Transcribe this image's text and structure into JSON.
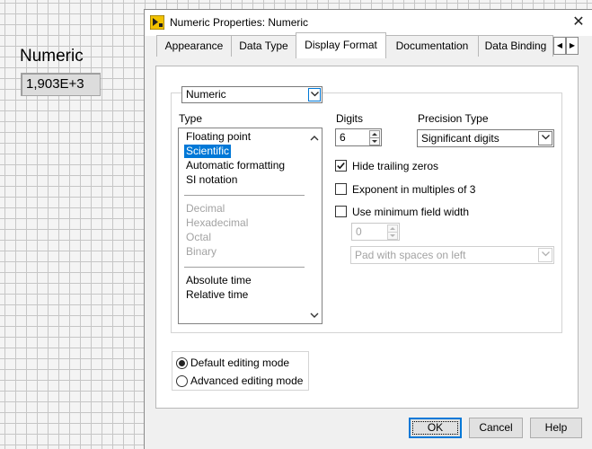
{
  "front_panel": {
    "label": "Numeric",
    "value": "1,903E+3"
  },
  "dialog": {
    "title": "Numeric Properties: Numeric",
    "close_glyph": "✕"
  },
  "tabs": [
    {
      "label": "Appearance"
    },
    {
      "label": "Data Type"
    },
    {
      "label": "Display Format"
    },
    {
      "label": "Documentation"
    },
    {
      "label": "Data Binding"
    }
  ],
  "tab_scroll": {
    "left": "◀",
    "right": "▶"
  },
  "display_format": {
    "format_select": {
      "value": "Numeric"
    },
    "type": {
      "label": "Type",
      "items": [
        {
          "label": "Floating point"
        },
        {
          "label": "Scientific",
          "selected": true
        },
        {
          "label": "Automatic formatting"
        },
        {
          "label": "SI notation"
        },
        {
          "label": "Decimal",
          "disabled": true
        },
        {
          "label": "Hexadecimal",
          "disabled": true
        },
        {
          "label": "Octal",
          "disabled": true
        },
        {
          "label": "Binary",
          "disabled": true
        },
        {
          "label": "Absolute time"
        },
        {
          "label": "Relative time"
        }
      ]
    },
    "digits": {
      "label": "Digits",
      "value": "6"
    },
    "precision_type": {
      "label": "Precision Type",
      "value": "Significant digits"
    },
    "hide_trailing_zeros": {
      "label": "Hide trailing zeros",
      "checked": true
    },
    "exponent_multiples_of_3": {
      "label": "Exponent in multiples of 3",
      "checked": false
    },
    "use_min_field_width": {
      "label": "Use minimum field width",
      "checked": false
    },
    "min_field_width": {
      "value": "0"
    },
    "padding": {
      "value": "Pad with spaces on left"
    }
  },
  "editing_mode": {
    "default": {
      "label": "Default editing mode",
      "selected": true
    },
    "advanced": {
      "label": "Advanced editing mode",
      "selected": false
    }
  },
  "buttons": {
    "ok": "OK",
    "cancel": "Cancel",
    "help": "Help"
  }
}
